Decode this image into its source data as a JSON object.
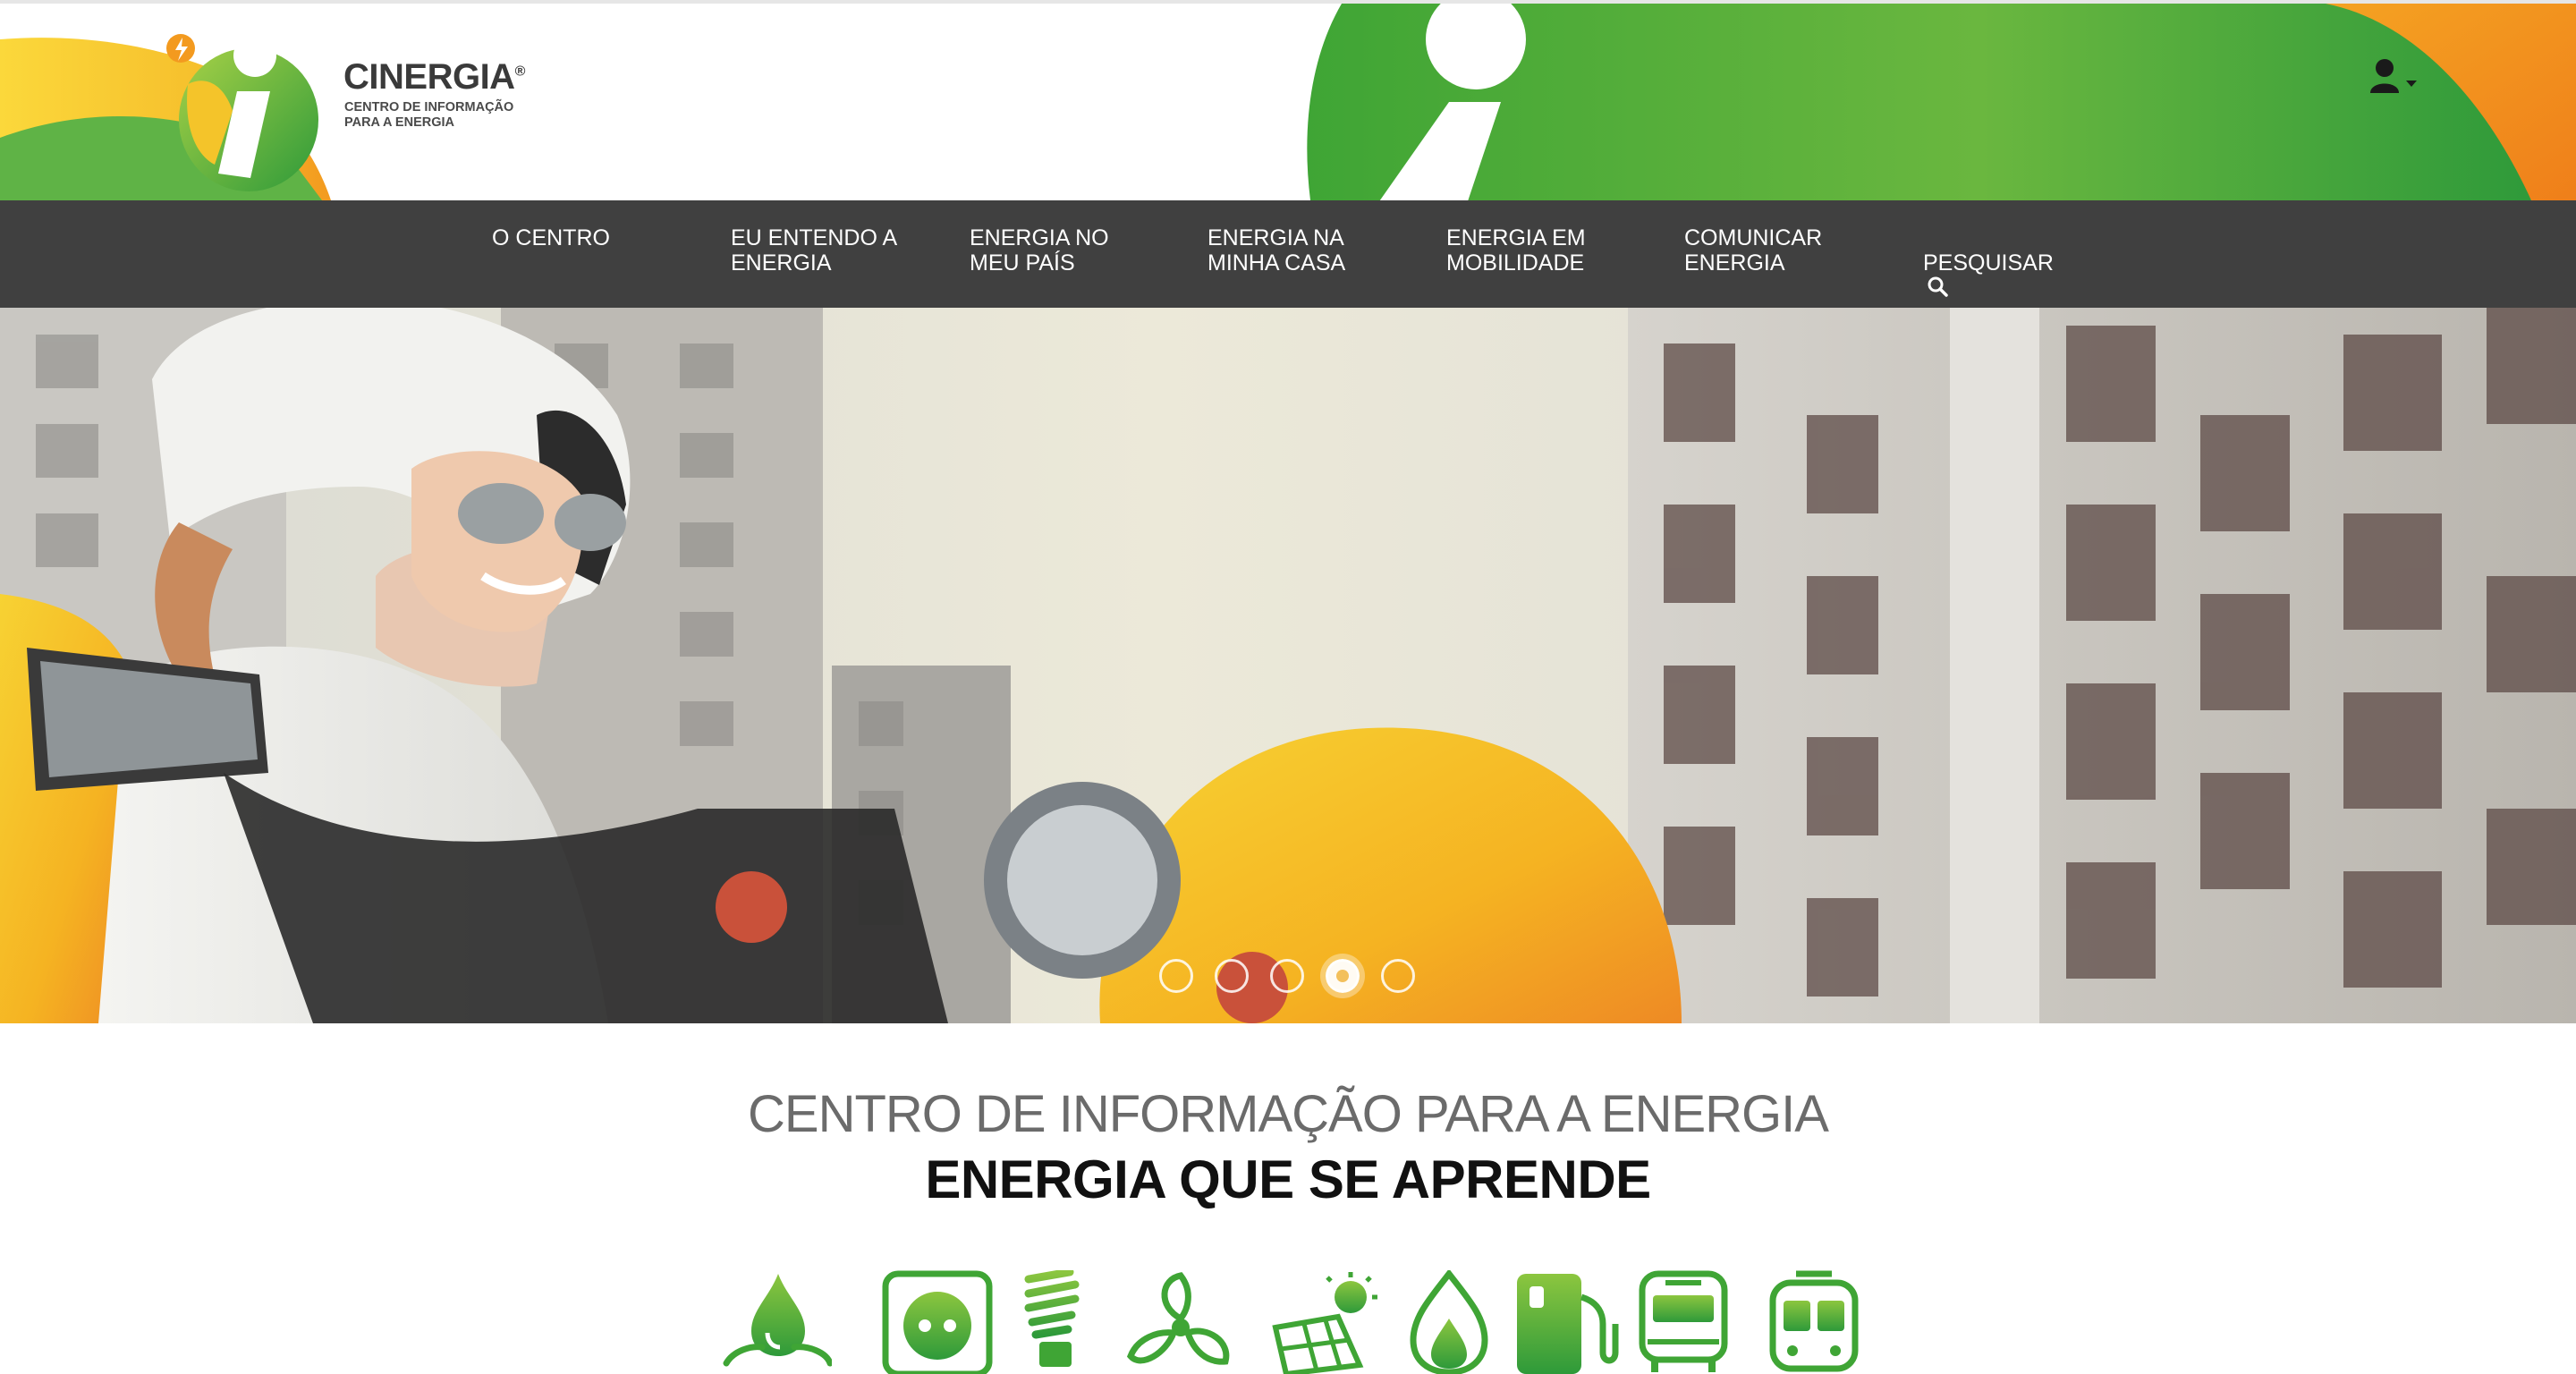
{
  "brand": {
    "name": "CINERGIA",
    "registered": "®",
    "tagline_line1": "CENTRO DE INFORMAÇÃO",
    "tagline_line2": "PARA A ENERGIA",
    "colors": {
      "green": "#3fa535",
      "light_green": "#8cc63f",
      "orange": "#f39200",
      "yellow": "#fbd83b"
    }
  },
  "user_menu": {
    "icon": "user-icon",
    "caret": "caret-down-icon"
  },
  "nav": {
    "items": [
      {
        "label": "O CENTRO"
      },
      {
        "label": "EU ENTENDO A\nENERGIA"
      },
      {
        "label": "ENERGIA NO\nMEU PAÍS"
      },
      {
        "label": "ENERGIA NA\nMINHA CASA"
      },
      {
        "label": "ENERGIA EM\nMOBILIDADE"
      },
      {
        "label": "COMUNICAR\nENERGIA"
      },
      {
        "label": "PESQUISAR"
      }
    ],
    "search_icon": "search-icon"
  },
  "carousel": {
    "slide_count": 5,
    "active_index": 3,
    "image": "woman-on-motorcycle-photo"
  },
  "intro": {
    "title": "CENTRO DE INFORMAÇÃO PARA A ENERGIA",
    "subtitle": "ENERGIA QUE SE APRENDE"
  },
  "topic_icons": [
    "water-drop-icon",
    "power-socket-icon",
    "energy-saving-bulb-icon",
    "wind-turbine-icon",
    "solar-panel-icon",
    "gas-flame-icon",
    "fuel-pump-icon",
    "bus-icon",
    "train-icon"
  ]
}
